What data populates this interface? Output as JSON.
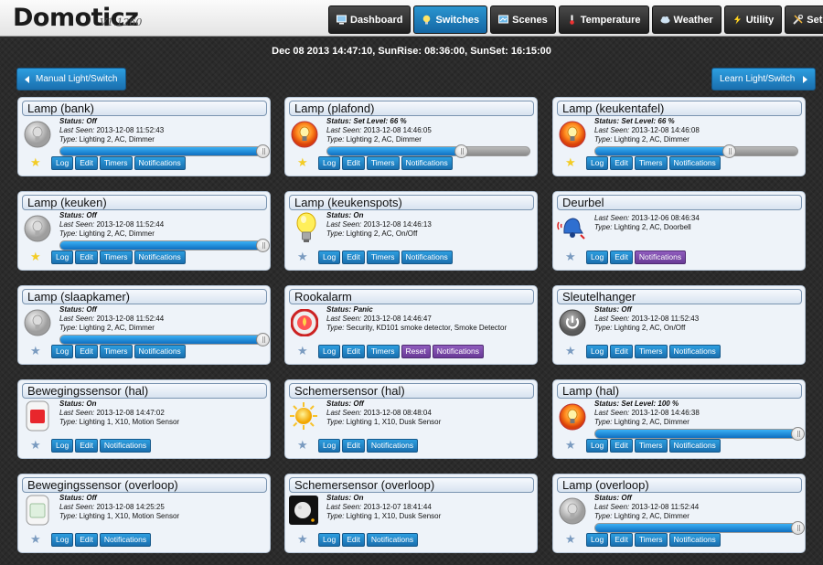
{
  "app": {
    "title": "Domoticz",
    "version": "V1.1260"
  },
  "nav": [
    {
      "label": "Dashboard",
      "icon": "monitor-icon",
      "active": false
    },
    {
      "label": "Switches",
      "icon": "bulb-icon",
      "active": true
    },
    {
      "label": "Scenes",
      "icon": "scenes-icon",
      "active": false
    },
    {
      "label": "Temperature",
      "icon": "thermometer-icon",
      "active": false
    },
    {
      "label": "Weather",
      "icon": "cloud-icon",
      "active": false
    },
    {
      "label": "Utility",
      "icon": "lightning-icon",
      "active": false
    },
    {
      "label": "Setup",
      "icon": "tools-icon",
      "active": false
    }
  ],
  "dateline": "Dec 08 2013 14:47:10, SunRise: 08:36:00, SunSet: 16:15:00",
  "buttons": {
    "manual": "Manual Light/Switch",
    "learn": "Learn Light/Switch"
  },
  "labels": {
    "status": "Status:",
    "last_seen": "Last Seen:",
    "type": "Type:"
  },
  "colors": {
    "accent": "#1a7bbd",
    "purple": "#7a4aa6",
    "star": "#f3cc25"
  },
  "cards": [
    {
      "title": "Lamp (bank)",
      "status": "Off",
      "last_seen": "2013-12-08 11:52:43",
      "type": "Lighting 2, AC, Dimmer",
      "icon": "bulb-off-icon",
      "slider_level": 1.0,
      "favorite": true,
      "buttons": [
        "Log",
        "Edit",
        "Timers",
        "Notifications"
      ]
    },
    {
      "title": "Lamp (plafond)",
      "status": "Set Level: 66 %",
      "last_seen": "2013-12-08 14:46:05",
      "type": "Lighting 2, AC, Dimmer",
      "icon": "bulb-on-icon",
      "slider_level": 0.66,
      "favorite": true,
      "buttons": [
        "Log",
        "Edit",
        "Timers",
        "Notifications"
      ]
    },
    {
      "title": "Lamp (keukentafel)",
      "status": "Set Level: 66 %",
      "last_seen": "2013-12-08 14:46:08",
      "type": "Lighting 2, AC, Dimmer",
      "icon": "bulb-on-icon",
      "slider_level": 0.66,
      "favorite": true,
      "buttons": [
        "Log",
        "Edit",
        "Timers",
        "Notifications"
      ]
    },
    {
      "title": "Lamp (keuken)",
      "status": "Off",
      "last_seen": "2013-12-08 11:52:44",
      "type": "Lighting 2, AC, Dimmer",
      "icon": "bulb-off-icon",
      "slider_level": 1.0,
      "favorite": true,
      "buttons": [
        "Log",
        "Edit",
        "Timers",
        "Notifications"
      ]
    },
    {
      "title": "Lamp (keukenspots)",
      "status": "On",
      "last_seen": "2013-12-08 14:46:13",
      "type": "Lighting 2, AC, On/Off",
      "icon": "bulb-yellow-icon",
      "favorite": false,
      "buttons": [
        "Log",
        "Edit",
        "Timers",
        "Notifications"
      ]
    },
    {
      "title": "Deurbel",
      "last_seen": "2013-12-06 08:46:34",
      "type": "Lighting 2, AC, Doorbell",
      "icon": "doorbell-icon",
      "favorite": false,
      "buttons": [
        "Log",
        "Edit",
        "Notifications"
      ],
      "purple": [
        "Notifications"
      ]
    },
    {
      "title": "Lamp (slaapkamer)",
      "status": "Off",
      "last_seen": "2013-12-08 11:52:44",
      "type": "Lighting 2, AC, Dimmer",
      "icon": "bulb-off-icon",
      "slider_level": 1.0,
      "favorite": false,
      "buttons": [
        "Log",
        "Edit",
        "Timers",
        "Notifications"
      ]
    },
    {
      "title": "Rookalarm",
      "status": "Panic",
      "last_seen": "2013-12-08 14:46:47",
      "type": "Security, KD101 smoke detector, Smoke Detector",
      "icon": "smoke-alarm-icon",
      "favorite": false,
      "buttons": [
        "Log",
        "Edit",
        "Timers",
        "Reset",
        "Notifications"
      ],
      "purple": [
        "Reset",
        "Notifications"
      ]
    },
    {
      "title": "Sleutelhanger",
      "status": "Off",
      "last_seen": "2013-12-08 11:52:43",
      "type": "Lighting 2, AC, On/Off",
      "icon": "power-icon",
      "favorite": false,
      "buttons": [
        "Log",
        "Edit",
        "Timers",
        "Notifications"
      ]
    },
    {
      "title": "Bewegingssensor (hal)",
      "status": "On",
      "last_seen": "2013-12-08 14:47:02",
      "type": "Lighting 1, X10, Motion Sensor",
      "icon": "motion-on-icon",
      "favorite": false,
      "buttons": [
        "Log",
        "Edit",
        "Notifications"
      ]
    },
    {
      "title": "Schemersensor (hal)",
      "status": "Off",
      "last_seen": "2013-12-08 08:48:04",
      "type": "Lighting 1, X10, Dusk Sensor",
      "icon": "sun-icon",
      "favorite": false,
      "buttons": [
        "Log",
        "Edit",
        "Notifications"
      ]
    },
    {
      "title": "Lamp (hal)",
      "status": "Set Level: 100 %",
      "last_seen": "2013-12-08 14:46:38",
      "type": "Lighting 2, AC, Dimmer",
      "icon": "bulb-on-icon",
      "slider_level": 1.0,
      "favorite": false,
      "buttons": [
        "Log",
        "Edit",
        "Timers",
        "Notifications"
      ]
    },
    {
      "title": "Bewegingssensor (overloop)",
      "status": "Off",
      "last_seen": "2013-12-08 14:25:25",
      "type": "Lighting 1, X10, Motion Sensor",
      "icon": "motion-off-icon",
      "favorite": false,
      "buttons": [
        "Log",
        "Edit",
        "Notifications"
      ]
    },
    {
      "title": "Schemersensor (overloop)",
      "status": "On",
      "last_seen": "2013-12-07 18:41:44",
      "type": "Lighting 1, X10, Dusk Sensor",
      "icon": "moon-icon",
      "favorite": false,
      "buttons": [
        "Log",
        "Edit",
        "Notifications"
      ]
    },
    {
      "title": "Lamp (overloop)",
      "status": "Off",
      "last_seen": "2013-12-08 11:52:44",
      "type": "Lighting 2, AC, Dimmer",
      "icon": "bulb-off-icon",
      "slider_level": 1.0,
      "favorite": false,
      "buttons": [
        "Log",
        "Edit",
        "Timers",
        "Notifications"
      ]
    }
  ]
}
